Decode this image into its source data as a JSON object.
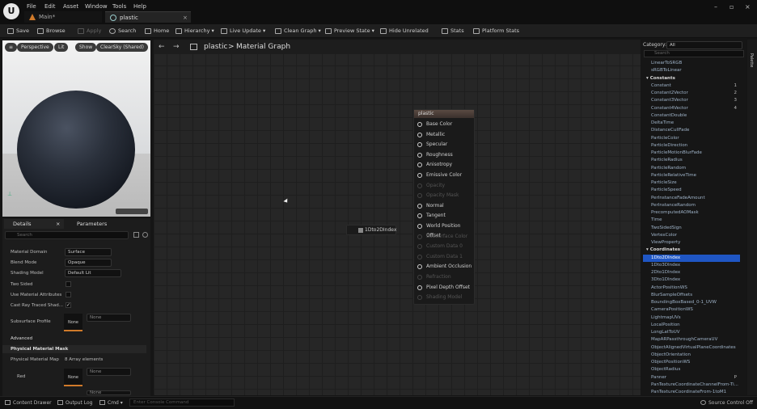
{
  "menu": [
    "File",
    "Edit",
    "Asset",
    "Window",
    "Tools",
    "Help"
  ],
  "tabs": [
    {
      "label": "Main*"
    },
    {
      "label": "plastic"
    }
  ],
  "window_controls": {
    "minimize": "–",
    "maximize": "▫",
    "close": "×",
    "tab_close": "×"
  },
  "logo": "U",
  "toolbar": {
    "save": "Save",
    "browse": "Browse",
    "apply": "Apply",
    "search": "Search",
    "home": "Home",
    "hierarchy": "Hierarchy",
    "live_update": "Live Update",
    "clean_graph": "Clean Graph",
    "preview_state": "Preview State",
    "hide_unrelated": "Hide Unrelated",
    "stats": "Stats",
    "platform_stats": "Platform Stats"
  },
  "viewport": {
    "perspective": "Perspective",
    "lit": "Lit",
    "show": "Show",
    "sky": "ClearSky (Shared)"
  },
  "graph": {
    "breadcrumb_root": "plastic",
    "breadcrumb_sep": ">",
    "breadcrumb_page": "Material Graph",
    "back": "←",
    "forward": "→"
  },
  "material_node": {
    "title": "plastic",
    "pins": [
      {
        "label": "Base Color",
        "enabled": true
      },
      {
        "label": "Metallic",
        "enabled": true
      },
      {
        "label": "Specular",
        "enabled": true
      },
      {
        "label": "Roughness",
        "enabled": true
      },
      {
        "label": "Anisotropy",
        "enabled": true
      },
      {
        "label": "Emissive Color",
        "enabled": true
      },
      {
        "label": "Opacity",
        "enabled": false
      },
      {
        "label": "Opacity Mask",
        "enabled": false
      },
      {
        "label": "Normal",
        "enabled": true
      },
      {
        "label": "Tangent",
        "enabled": true
      },
      {
        "label": "World Position Offset",
        "enabled": true
      },
      {
        "label": "Subsurface Color",
        "enabled": false
      },
      {
        "label": "Custom Data 0",
        "enabled": false
      },
      {
        "label": "Custom Data 1",
        "enabled": false
      },
      {
        "label": "Ambient Occlusion",
        "enabled": true
      },
      {
        "label": "Refraction",
        "enabled": false
      },
      {
        "label": "Pixel Depth Offset",
        "enabled": true
      },
      {
        "label": "Shading Model",
        "enabled": false
      }
    ]
  },
  "placed_node": {
    "label": "1Dto2DIndex"
  },
  "details": {
    "tab_details": "Details",
    "tab_parameters": "Parameters",
    "search_placeholder": "Search",
    "rows": [
      {
        "label": "Material Domain",
        "value": "Surface"
      },
      {
        "label": "Blend Mode",
        "value": "Opaque"
      },
      {
        "label": "Shading Model",
        "value": "Default Lit"
      }
    ],
    "checks": [
      {
        "label": "Two Sided",
        "checked": false
      },
      {
        "label": "Use Material Attributes",
        "checked": false
      },
      {
        "label": "Cast Ray Traced Shad...",
        "checked": true
      }
    ],
    "subsurface_label": "Subsurface Profile",
    "subsurface_value": "None",
    "subsurface_thumb": "None",
    "advanced": "Advanced",
    "physical_mask": "Physical Material Mask",
    "physical_map": "Physical Material Map",
    "physical_map_value": "8 Array elements",
    "red_label": "Red",
    "red_thumb": "None",
    "red_value": "None",
    "next_value": "None"
  },
  "palette": {
    "category_label": "Category:",
    "category_value": "All",
    "search_placeholder": "Search",
    "items": [
      {
        "label": "LinearToSRGB",
        "type": "item"
      },
      {
        "label": "sRGBToLinear",
        "type": "item"
      },
      {
        "label": "Constants",
        "type": "cat"
      },
      {
        "label": "Constant",
        "type": "item",
        "shortcut": "1"
      },
      {
        "label": "Constant2Vector",
        "type": "item",
        "shortcut": "2"
      },
      {
        "label": "Constant3Vector",
        "type": "item",
        "shortcut": "3"
      },
      {
        "label": "Constant4Vector",
        "type": "item",
        "shortcut": "4"
      },
      {
        "label": "ConstantDouble",
        "type": "item"
      },
      {
        "label": "DeltaTime",
        "type": "item"
      },
      {
        "label": "DistanceCullFade",
        "type": "item"
      },
      {
        "label": "ParticleColor",
        "type": "item"
      },
      {
        "label": "ParticleDirection",
        "type": "item"
      },
      {
        "label": "ParticleMotionBlurFade",
        "type": "item"
      },
      {
        "label": "ParticleRadius",
        "type": "item"
      },
      {
        "label": "ParticleRandom",
        "type": "item"
      },
      {
        "label": "ParticleRelativeTime",
        "type": "item"
      },
      {
        "label": "ParticleSize",
        "type": "item"
      },
      {
        "label": "ParticleSpeed",
        "type": "item"
      },
      {
        "label": "PerInstanceFadeAmount",
        "type": "item"
      },
      {
        "label": "PerInstanceRandom",
        "type": "item"
      },
      {
        "label": "PrecomputedAOMask",
        "type": "item"
      },
      {
        "label": "Time",
        "type": "item"
      },
      {
        "label": "TwoSidedSign",
        "type": "item"
      },
      {
        "label": "VertexColor",
        "type": "item"
      },
      {
        "label": "ViewProperty",
        "type": "item"
      },
      {
        "label": "Coordinates",
        "type": "cat"
      },
      {
        "label": "1Dto2DIndex",
        "type": "sel"
      },
      {
        "label": "1Dto3DIndex",
        "type": "item"
      },
      {
        "label": "2Dto1DIndex",
        "type": "item"
      },
      {
        "label": "3Dto1DIndex",
        "type": "item"
      },
      {
        "label": "ActorPositionWS",
        "type": "item"
      },
      {
        "label": "BlurSampleOffsets",
        "type": "item"
      },
      {
        "label": "BoundingBoxBased_0-1_UVW",
        "type": "item"
      },
      {
        "label": "CameraPositionWS",
        "type": "item"
      },
      {
        "label": "LightmapUVs",
        "type": "item"
      },
      {
        "label": "LocalPosition",
        "type": "item"
      },
      {
        "label": "LongLatToUV",
        "type": "item"
      },
      {
        "label": "MapARPassthroughCameraUV",
        "type": "item"
      },
      {
        "label": "ObjectAlignedVirtualPlaneCoordinates",
        "type": "item"
      },
      {
        "label": "ObjectOrientation",
        "type": "item"
      },
      {
        "label": "ObjectPositionWS",
        "type": "item"
      },
      {
        "label": "ObjectRadius",
        "type": "item"
      },
      {
        "label": "Panner",
        "type": "item",
        "shortcut": "P"
      },
      {
        "label": "PanTextureCoordinateChannelFrom-Ti...",
        "type": "item"
      },
      {
        "label": "PanTextureCoordinateFrom-1toM1",
        "type": "item"
      }
    ]
  },
  "right_strip": {
    "palette_tab": "Palette"
  },
  "statusbar": {
    "content_drawer": "Content Drawer",
    "output_log": "Output Log",
    "cmd": "Cmd",
    "console_placeholder": "Enter Console Command",
    "source_control": "Source Control Off"
  },
  "colors": {
    "accent": "#1f56c4",
    "node_header": "#5a4a42",
    "background": "#151515"
  }
}
